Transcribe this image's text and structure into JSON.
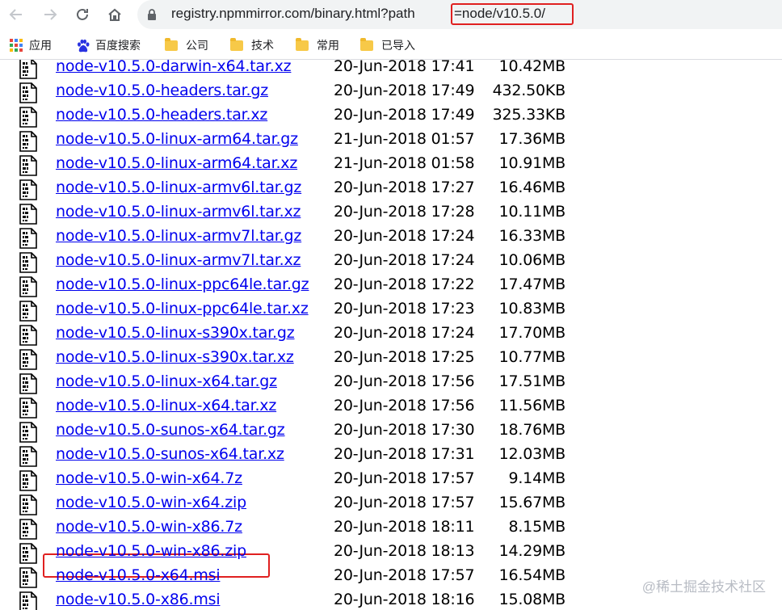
{
  "browser": {
    "url_host": "registry.npmmirror.com/binary.html?path",
    "url_path": "=node/v10.5.0/",
    "nav_icons": [
      "back-arrow-icon",
      "forward-arrow-icon",
      "reload-icon",
      "home-icon",
      "lock-icon"
    ]
  },
  "bookmarks": [
    {
      "label": "应用",
      "icon": "apps-grid-icon"
    },
    {
      "label": "百度搜索",
      "icon": "baidu-paw-icon"
    },
    {
      "label": "公司",
      "icon": "folder-icon"
    },
    {
      "label": "技术",
      "icon": "folder-icon"
    },
    {
      "label": "常用",
      "icon": "folder-icon"
    },
    {
      "label": "已导入",
      "icon": "folder-icon"
    }
  ],
  "files": [
    {
      "name": "node-v10.5.0-darwin-x64.tar.xz",
      "date": "20-Jun-2018 17:41",
      "size": "10.42MB"
    },
    {
      "name": "node-v10.5.0-headers.tar.gz",
      "date": "20-Jun-2018 17:49",
      "size": "432.50KB"
    },
    {
      "name": "node-v10.5.0-headers.tar.xz",
      "date": "20-Jun-2018 17:49",
      "size": "325.33KB"
    },
    {
      "name": "node-v10.5.0-linux-arm64.tar.gz",
      "date": "21-Jun-2018 01:57",
      "size": "17.36MB"
    },
    {
      "name": "node-v10.5.0-linux-arm64.tar.xz",
      "date": "21-Jun-2018 01:58",
      "size": "10.91MB"
    },
    {
      "name": "node-v10.5.0-linux-armv6l.tar.gz",
      "date": "20-Jun-2018 17:27",
      "size": "16.46MB"
    },
    {
      "name": "node-v10.5.0-linux-armv6l.tar.xz",
      "date": "20-Jun-2018 17:28",
      "size": "10.11MB"
    },
    {
      "name": "node-v10.5.0-linux-armv7l.tar.gz",
      "date": "20-Jun-2018 17:24",
      "size": "16.33MB"
    },
    {
      "name": "node-v10.5.0-linux-armv7l.tar.xz",
      "date": "20-Jun-2018 17:24",
      "size": "10.06MB"
    },
    {
      "name": "node-v10.5.0-linux-ppc64le.tar.gz",
      "date": "20-Jun-2018 17:22",
      "size": "17.47MB"
    },
    {
      "name": "node-v10.5.0-linux-ppc64le.tar.xz",
      "date": "20-Jun-2018 17:23",
      "size": "10.83MB"
    },
    {
      "name": "node-v10.5.0-linux-s390x.tar.gz",
      "date": "20-Jun-2018 17:24",
      "size": "17.70MB"
    },
    {
      "name": "node-v10.5.0-linux-s390x.tar.xz",
      "date": "20-Jun-2018 17:25",
      "size": "10.77MB"
    },
    {
      "name": "node-v10.5.0-linux-x64.tar.gz",
      "date": "20-Jun-2018 17:56",
      "size": "17.51MB"
    },
    {
      "name": "node-v10.5.0-linux-x64.tar.xz",
      "date": "20-Jun-2018 17:56",
      "size": "11.56MB"
    },
    {
      "name": "node-v10.5.0-sunos-x64.tar.gz",
      "date": "20-Jun-2018 17:30",
      "size": "18.76MB"
    },
    {
      "name": "node-v10.5.0-sunos-x64.tar.xz",
      "date": "20-Jun-2018 17:31",
      "size": "12.03MB"
    },
    {
      "name": "node-v10.5.0-win-x64.7z",
      "date": "20-Jun-2018 17:57",
      "size": "9.14MB"
    },
    {
      "name": "node-v10.5.0-win-x64.zip",
      "date": "20-Jun-2018 17:57",
      "size": "15.67MB"
    },
    {
      "name": "node-v10.5.0-win-x86.7z",
      "date": "20-Jun-2018 18:11",
      "size": "8.15MB"
    },
    {
      "name": "node-v10.5.0-win-x86.zip",
      "date": "20-Jun-2018 18:13",
      "size": "14.29MB"
    },
    {
      "name": "node-v10.5.0-x64.msi",
      "date": "20-Jun-2018 17:57",
      "size": "16.54MB"
    },
    {
      "name": "node-v10.5.0-x86.msi",
      "date": "20-Jun-2018 18:16",
      "size": "15.08MB"
    }
  ],
  "watermark": "@稀土掘金技术社区",
  "colors": {
    "link": "#0000ee",
    "highlight": "#e02020",
    "omnibox": "#f1f3f4"
  }
}
